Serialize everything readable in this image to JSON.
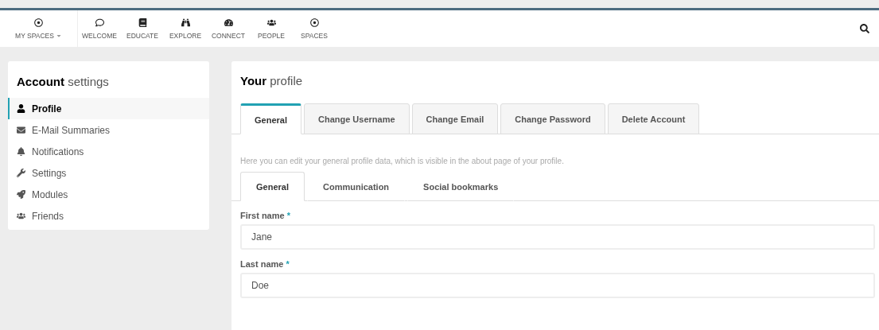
{
  "nav": {
    "items": [
      {
        "label": "MY SPACES",
        "dropdown": true
      },
      {
        "label": "WELCOME",
        "dropdown": false
      },
      {
        "label": "EDUCATE",
        "dropdown": false
      },
      {
        "label": "EXPLORE",
        "dropdown": false
      },
      {
        "label": "CONNECT",
        "dropdown": false
      },
      {
        "label": "PEOPLE",
        "dropdown": false
      },
      {
        "label": "SPACES",
        "dropdown": false
      }
    ]
  },
  "sidebar": {
    "title_bold": "Account",
    "title_rest": "settings",
    "items": [
      {
        "label": "Profile",
        "selected": true
      },
      {
        "label": "E-Mail Summaries",
        "selected": false
      },
      {
        "label": "Notifications",
        "selected": false
      },
      {
        "label": "Settings",
        "selected": false
      },
      {
        "label": "Modules",
        "selected": false
      },
      {
        "label": "Friends",
        "selected": false
      }
    ]
  },
  "main": {
    "title_bold": "Your",
    "title_rest": "profile",
    "tabs": [
      {
        "label": "General",
        "selected": true
      },
      {
        "label": "Change Username",
        "selected": false
      },
      {
        "label": "Change Email",
        "selected": false
      },
      {
        "label": "Change Password",
        "selected": false
      },
      {
        "label": "Delete Account",
        "selected": false
      }
    ],
    "description": "Here you can edit your general profile data, which is visible in the about page of your profile.",
    "subtabs": [
      {
        "label": "General",
        "selected": true
      },
      {
        "label": "Communication",
        "selected": false
      },
      {
        "label": "Social bookmarks",
        "selected": false
      }
    ],
    "fields": [
      {
        "label": "First name",
        "required": "*",
        "value": "Jane"
      },
      {
        "label": "Last name",
        "required": "*",
        "value": "Doe"
      }
    ]
  }
}
